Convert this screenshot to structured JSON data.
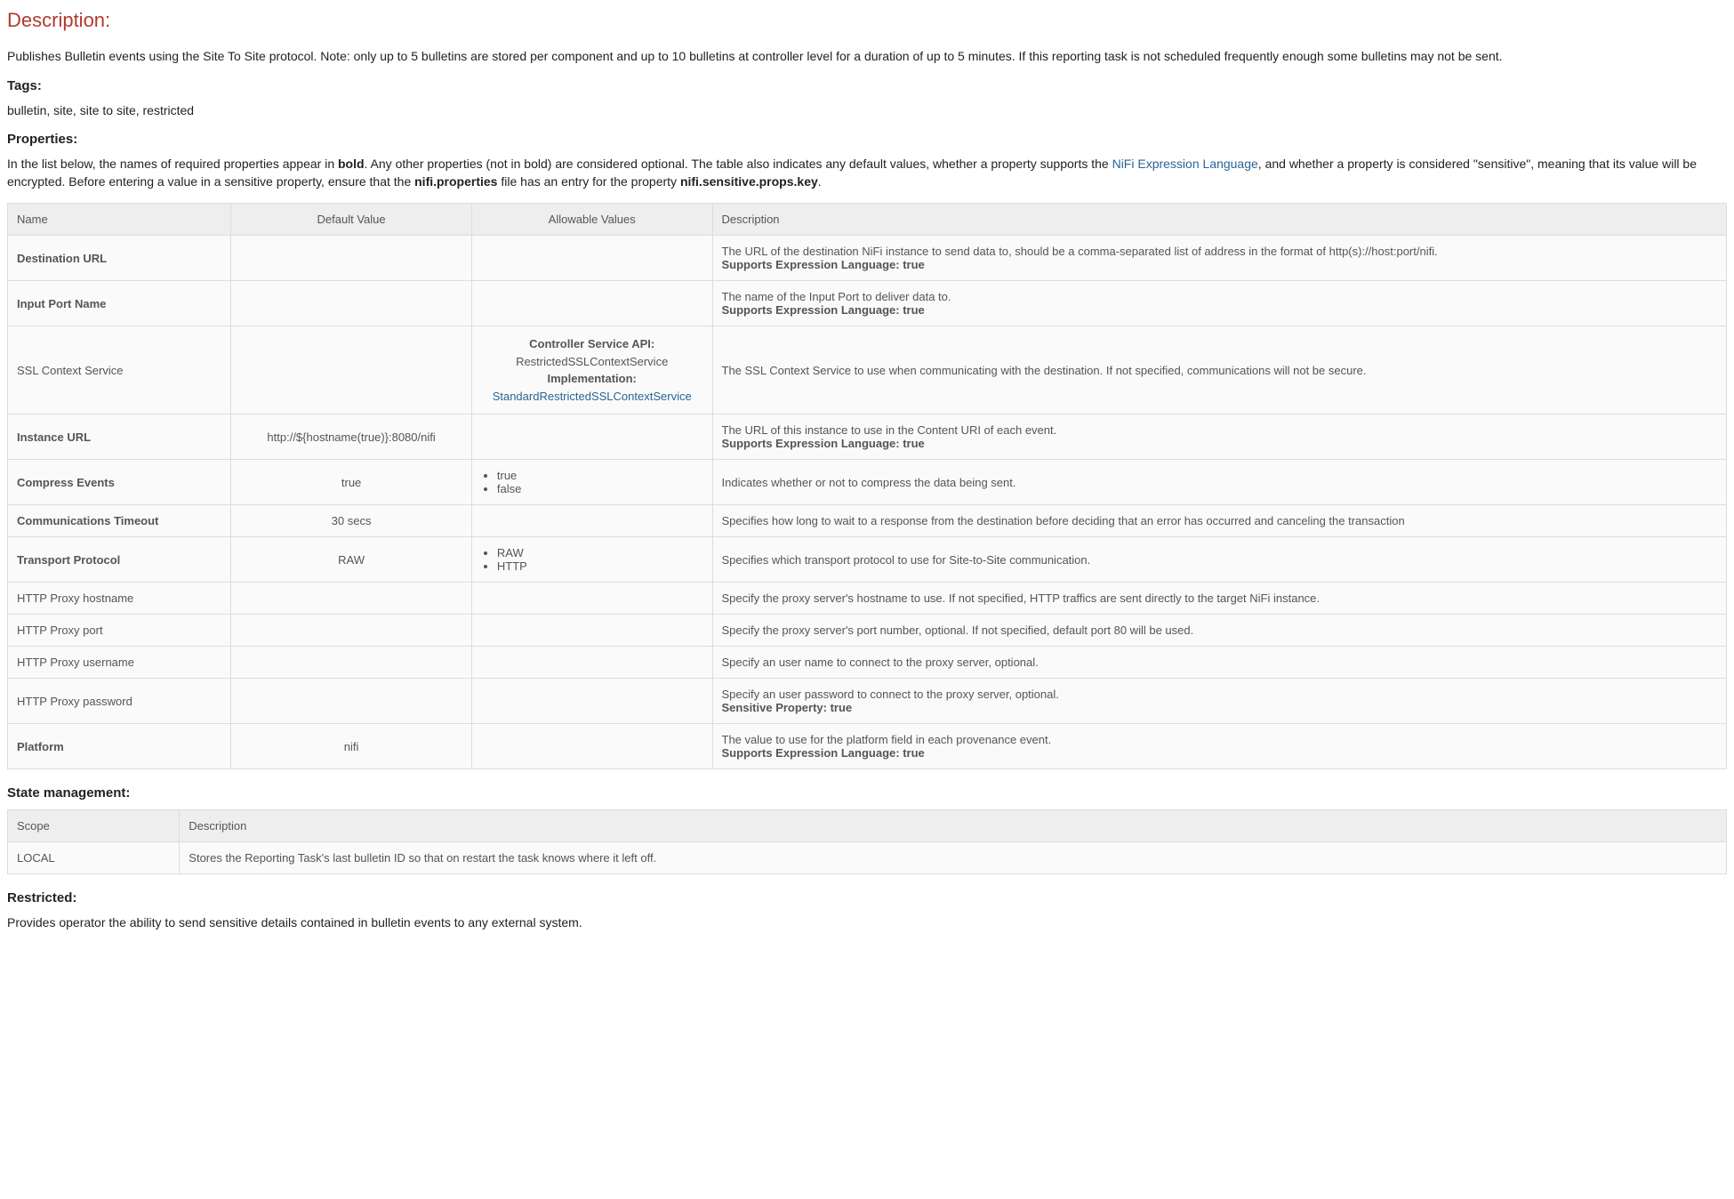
{
  "headings": {
    "description": "Description:",
    "tags": "Tags:",
    "properties": "Properties:",
    "state": "State management:",
    "restricted": "Restricted:"
  },
  "description_text": "Publishes Bulletin events using the Site To Site protocol. Note: only up to 5 bulletins are stored per component and up to 10 bulletins at controller level for a duration of up to 5 minutes. If this reporting task is not scheduled frequently enough some bulletins may not be sent.",
  "tags_text": "bulletin, site, site to site, restricted",
  "properties_intro": {
    "p1": "In the list below, the names of required properties appear in ",
    "bold": "bold",
    "p2": ". Any other properties (not in bold) are considered optional. The table also indicates any default values, whether a property supports the ",
    "link": "NiFi Expression Language",
    "p3": ", and whether a property is considered \"sensitive\", meaning that its value will be encrypted. Before entering a value in a sensitive property, ensure that the ",
    "nifi_props": "nifi.properties",
    "p4": " file has an entry for the property ",
    "key": "nifi.sensitive.props.key",
    "p5": "."
  },
  "table_headers": {
    "name": "Name",
    "default": "Default Value",
    "allowable": "Allowable Values",
    "description": "Description"
  },
  "api": {
    "title": "Controller Service API:",
    "service": "RestrictedSSLContextService",
    "impl_label": "Implementation:",
    "impl_link": "StandardRestrictedSSLContextService"
  },
  "props": {
    "dest_url": {
      "name": "Destination URL",
      "desc": "The URL of the destination NiFi instance to send data to, should be a comma-separated list of address in the format of http(s)://host:port/nifi.",
      "extra": "Supports Expression Language: true"
    },
    "input_port": {
      "name": "Input Port Name",
      "desc": "The name of the Input Port to deliver data to.",
      "extra": "Supports Expression Language: true"
    },
    "ssl": {
      "name": "SSL Context Service",
      "desc": "The SSL Context Service to use when communicating with the destination. If not specified, communications will not be secure."
    },
    "instance_url": {
      "name": "Instance URL",
      "def": "http://${hostname(true)}:8080/nifi",
      "desc": "The URL of this instance to use in the Content URI of each event.",
      "extra": "Supports Expression Language: true"
    },
    "compress": {
      "name": "Compress Events",
      "def": "true",
      "a1": "true",
      "a2": "false",
      "desc": "Indicates whether or not to compress the data being sent."
    },
    "timeout": {
      "name": "Communications Timeout",
      "def": "30 secs",
      "desc": "Specifies how long to wait to a response from the destination before deciding that an error has occurred and canceling the transaction"
    },
    "transport": {
      "name": "Transport Protocol",
      "def": "RAW",
      "a1": "RAW",
      "a2": "HTTP",
      "desc": "Specifies which transport protocol to use for Site-to-Site communication."
    },
    "proxy_host": {
      "name": "HTTP Proxy hostname",
      "desc": "Specify the proxy server's hostname to use. If not specified, HTTP traffics are sent directly to the target NiFi instance."
    },
    "proxy_port": {
      "name": "HTTP Proxy port",
      "desc": "Specify the proxy server's port number, optional. If not specified, default port 80 will be used."
    },
    "proxy_user": {
      "name": "HTTP Proxy username",
      "desc": "Specify an user name to connect to the proxy server, optional."
    },
    "proxy_pass": {
      "name": "HTTP Proxy password",
      "desc": "Specify an user password to connect to the proxy server, optional.",
      "extra": "Sensitive Property: true"
    },
    "platform": {
      "name": "Platform",
      "def": "nifi",
      "desc": "The value to use for the platform field in each provenance event.",
      "extra": "Supports Expression Language: true"
    }
  },
  "state_headers": {
    "scope": "Scope",
    "description": "Description"
  },
  "state_row": {
    "scope": "LOCAL",
    "desc": "Stores the Reporting Task's last bulletin ID so that on restart the task knows where it left off."
  },
  "restricted_text": "Provides operator the ability to send sensitive details contained in bulletin events to any external system."
}
